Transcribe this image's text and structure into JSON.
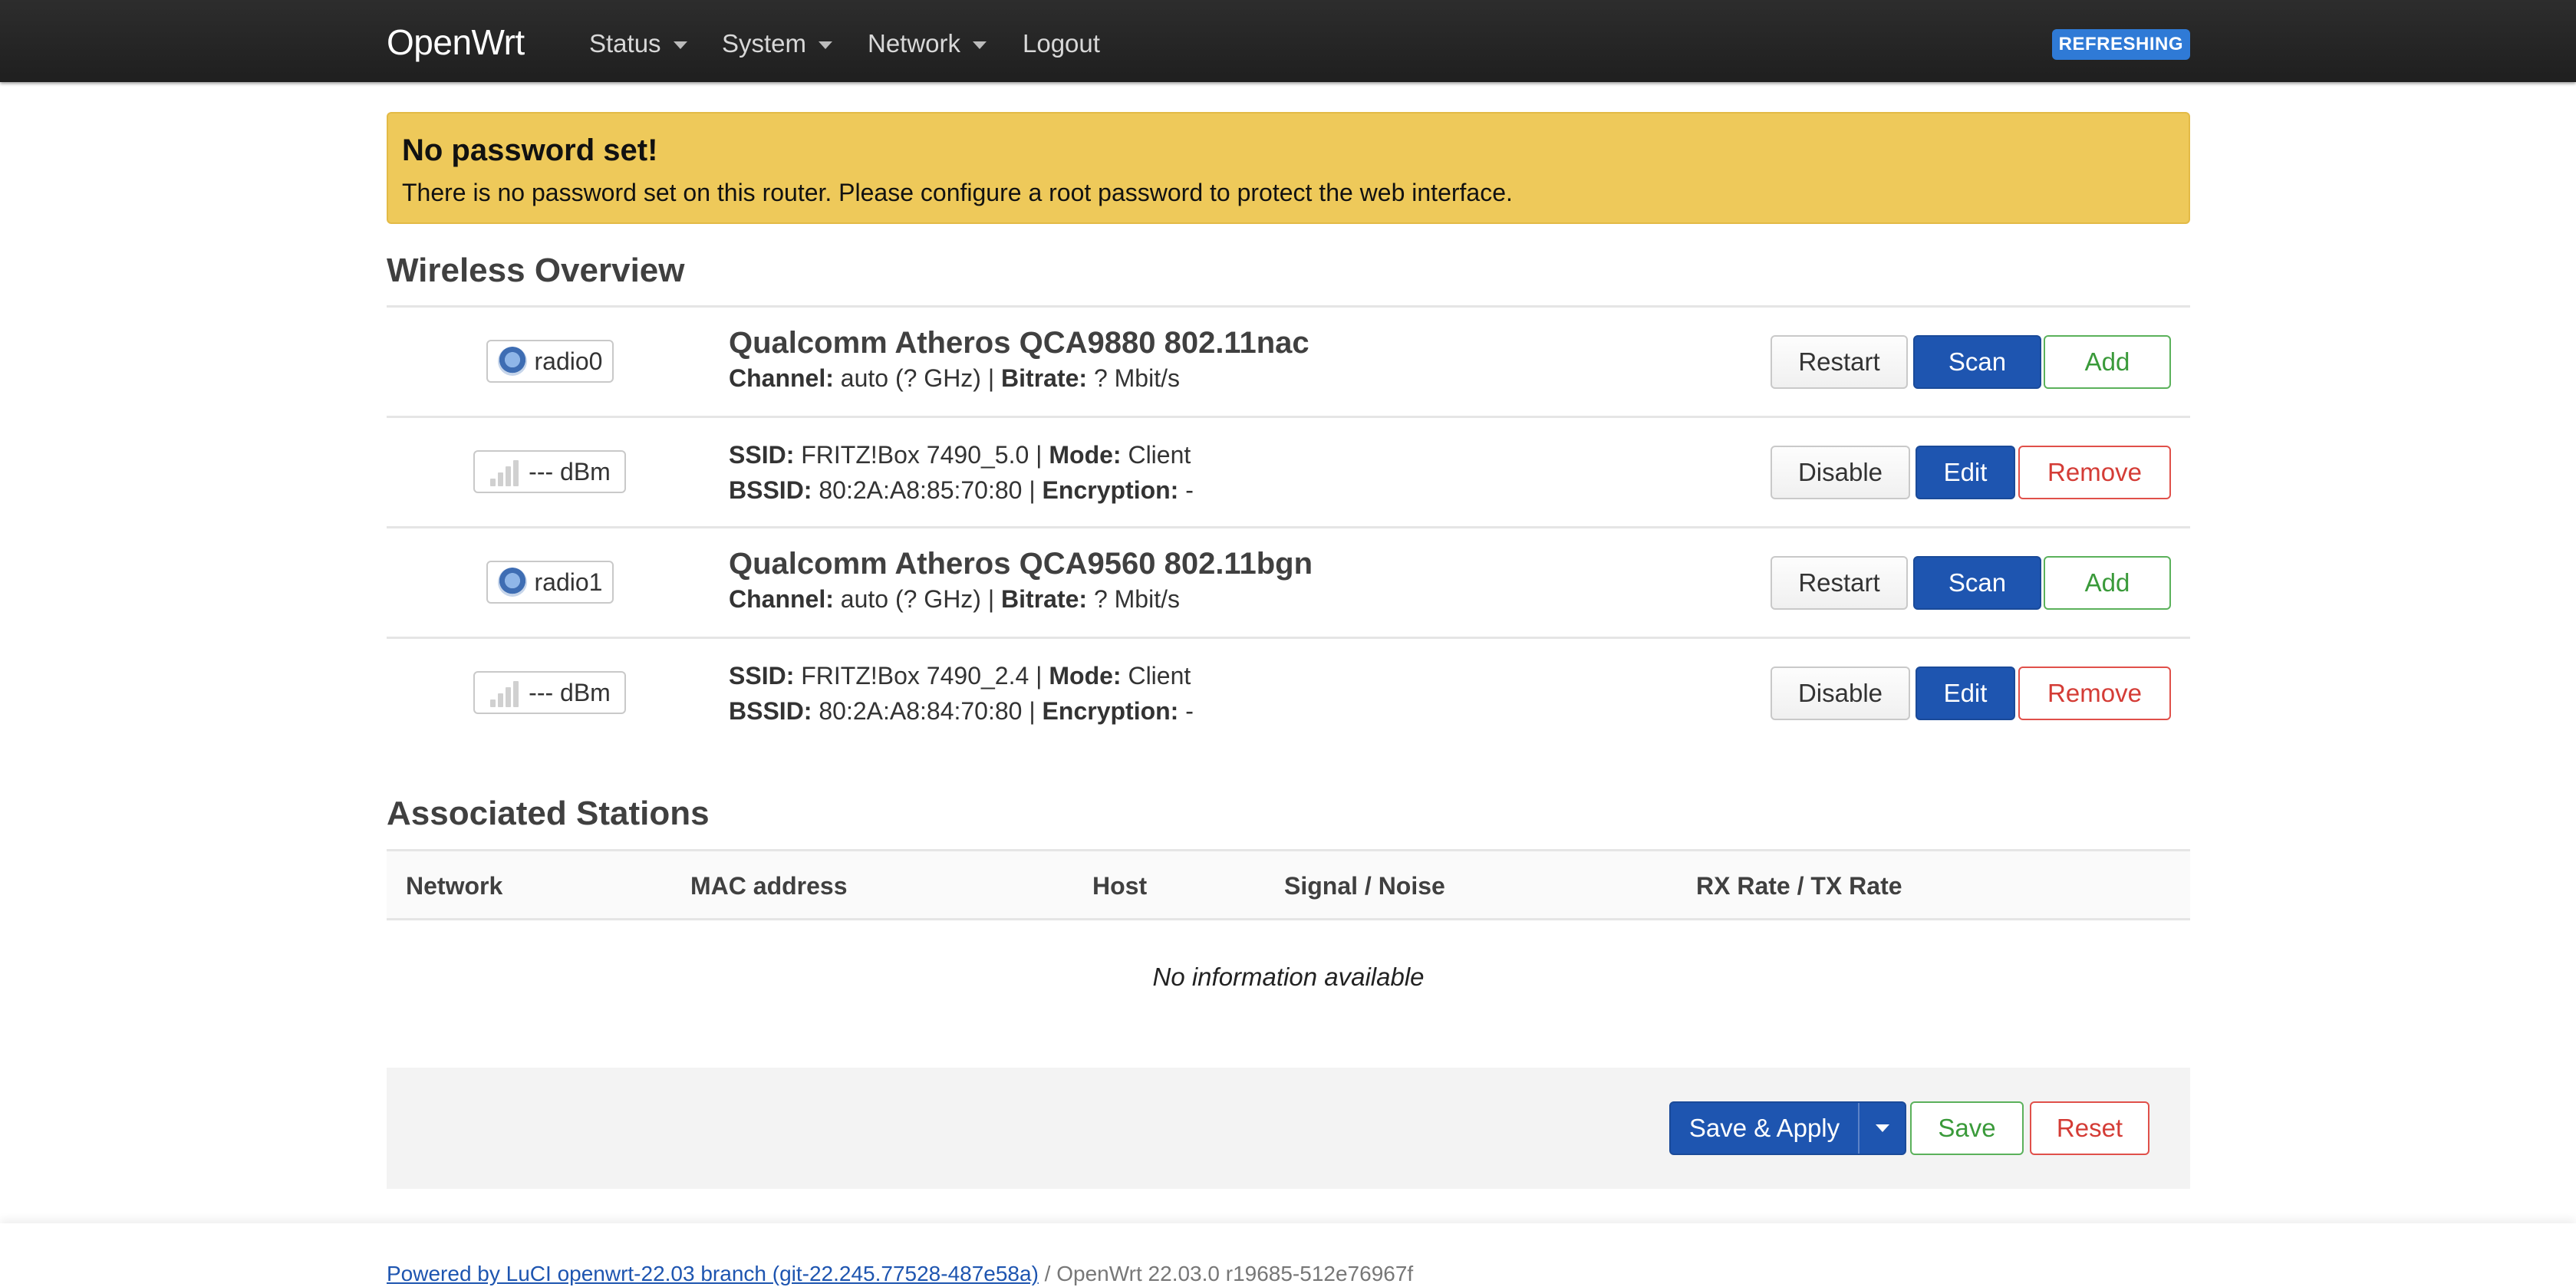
{
  "nav": {
    "brand": "OpenWrt",
    "menu": [
      {
        "label": "Status",
        "dropdown": true
      },
      {
        "label": "System",
        "dropdown": true
      },
      {
        "label": "Network",
        "dropdown": true
      },
      {
        "label": "Logout",
        "dropdown": false
      }
    ],
    "status_badge": "REFRESHING"
  },
  "alert": {
    "title": "No password set!",
    "text": "There is no password set on this router. Please configure a root password to protect the web interface."
  },
  "wireless": {
    "heading": "Wireless Overview",
    "rows": [
      {
        "kind": "radio",
        "badge": "radio0",
        "title": "Qualcomm Atheros QCA9880 802.11nac",
        "line1_k1": "Channel:",
        "line1_v1": " auto (? GHz) | ",
        "line1_k2": "Bitrate:",
        "line1_v2": " ? Mbit/s",
        "buttons": [
          "Restart",
          "Scan",
          "Add"
        ]
      },
      {
        "kind": "net",
        "badge": "--- dBm",
        "line1_k1": "SSID:",
        "line1_v1": " FRITZ!Box 7490_5.0 | ",
        "line1_k2": "Mode:",
        "line1_v2": " Client",
        "line2_k1": "BSSID:",
        "line2_v1": " 80:2A:A8:85:70:80 | ",
        "line2_k2": "Encryption:",
        "line2_v2": " -",
        "buttons": [
          "Disable",
          "Edit",
          "Remove"
        ]
      },
      {
        "kind": "radio",
        "badge": "radio1",
        "title": "Qualcomm Atheros QCA9560 802.11bgn",
        "line1_k1": "Channel:",
        "line1_v1": " auto (? GHz) | ",
        "line1_k2": "Bitrate:",
        "line1_v2": " ? Mbit/s",
        "buttons": [
          "Restart",
          "Scan",
          "Add"
        ]
      },
      {
        "kind": "net",
        "badge": "--- dBm",
        "line1_k1": "SSID:",
        "line1_v1": " FRITZ!Box 7490_2.4 | ",
        "line1_k2": "Mode:",
        "line1_v2": " Client",
        "line2_k1": "BSSID:",
        "line2_v1": " 80:2A:A8:84:70:80 | ",
        "line2_k2": "Encryption:",
        "line2_v2": " -",
        "buttons": [
          "Disable",
          "Edit",
          "Remove"
        ]
      }
    ]
  },
  "stations": {
    "heading": "Associated Stations",
    "columns": [
      "Network",
      "MAC address",
      "Host",
      "Signal / Noise",
      "RX Rate / TX Rate"
    ],
    "empty": "No information available"
  },
  "actions": {
    "save_apply": "Save & Apply",
    "save": "Save",
    "reset": "Reset"
  },
  "footer": {
    "link": "Powered by LuCI openwrt-22.03 branch (git-22.245.77528-487e58a)",
    "version": " / OpenWrt 22.03.0 r19685-512e76967f"
  },
  "colors": {
    "primary": "#1e55b0",
    "warning": "#eec95a",
    "success": "#3a9a3a",
    "danger": "#d43c36",
    "navbar": "#262626"
  }
}
